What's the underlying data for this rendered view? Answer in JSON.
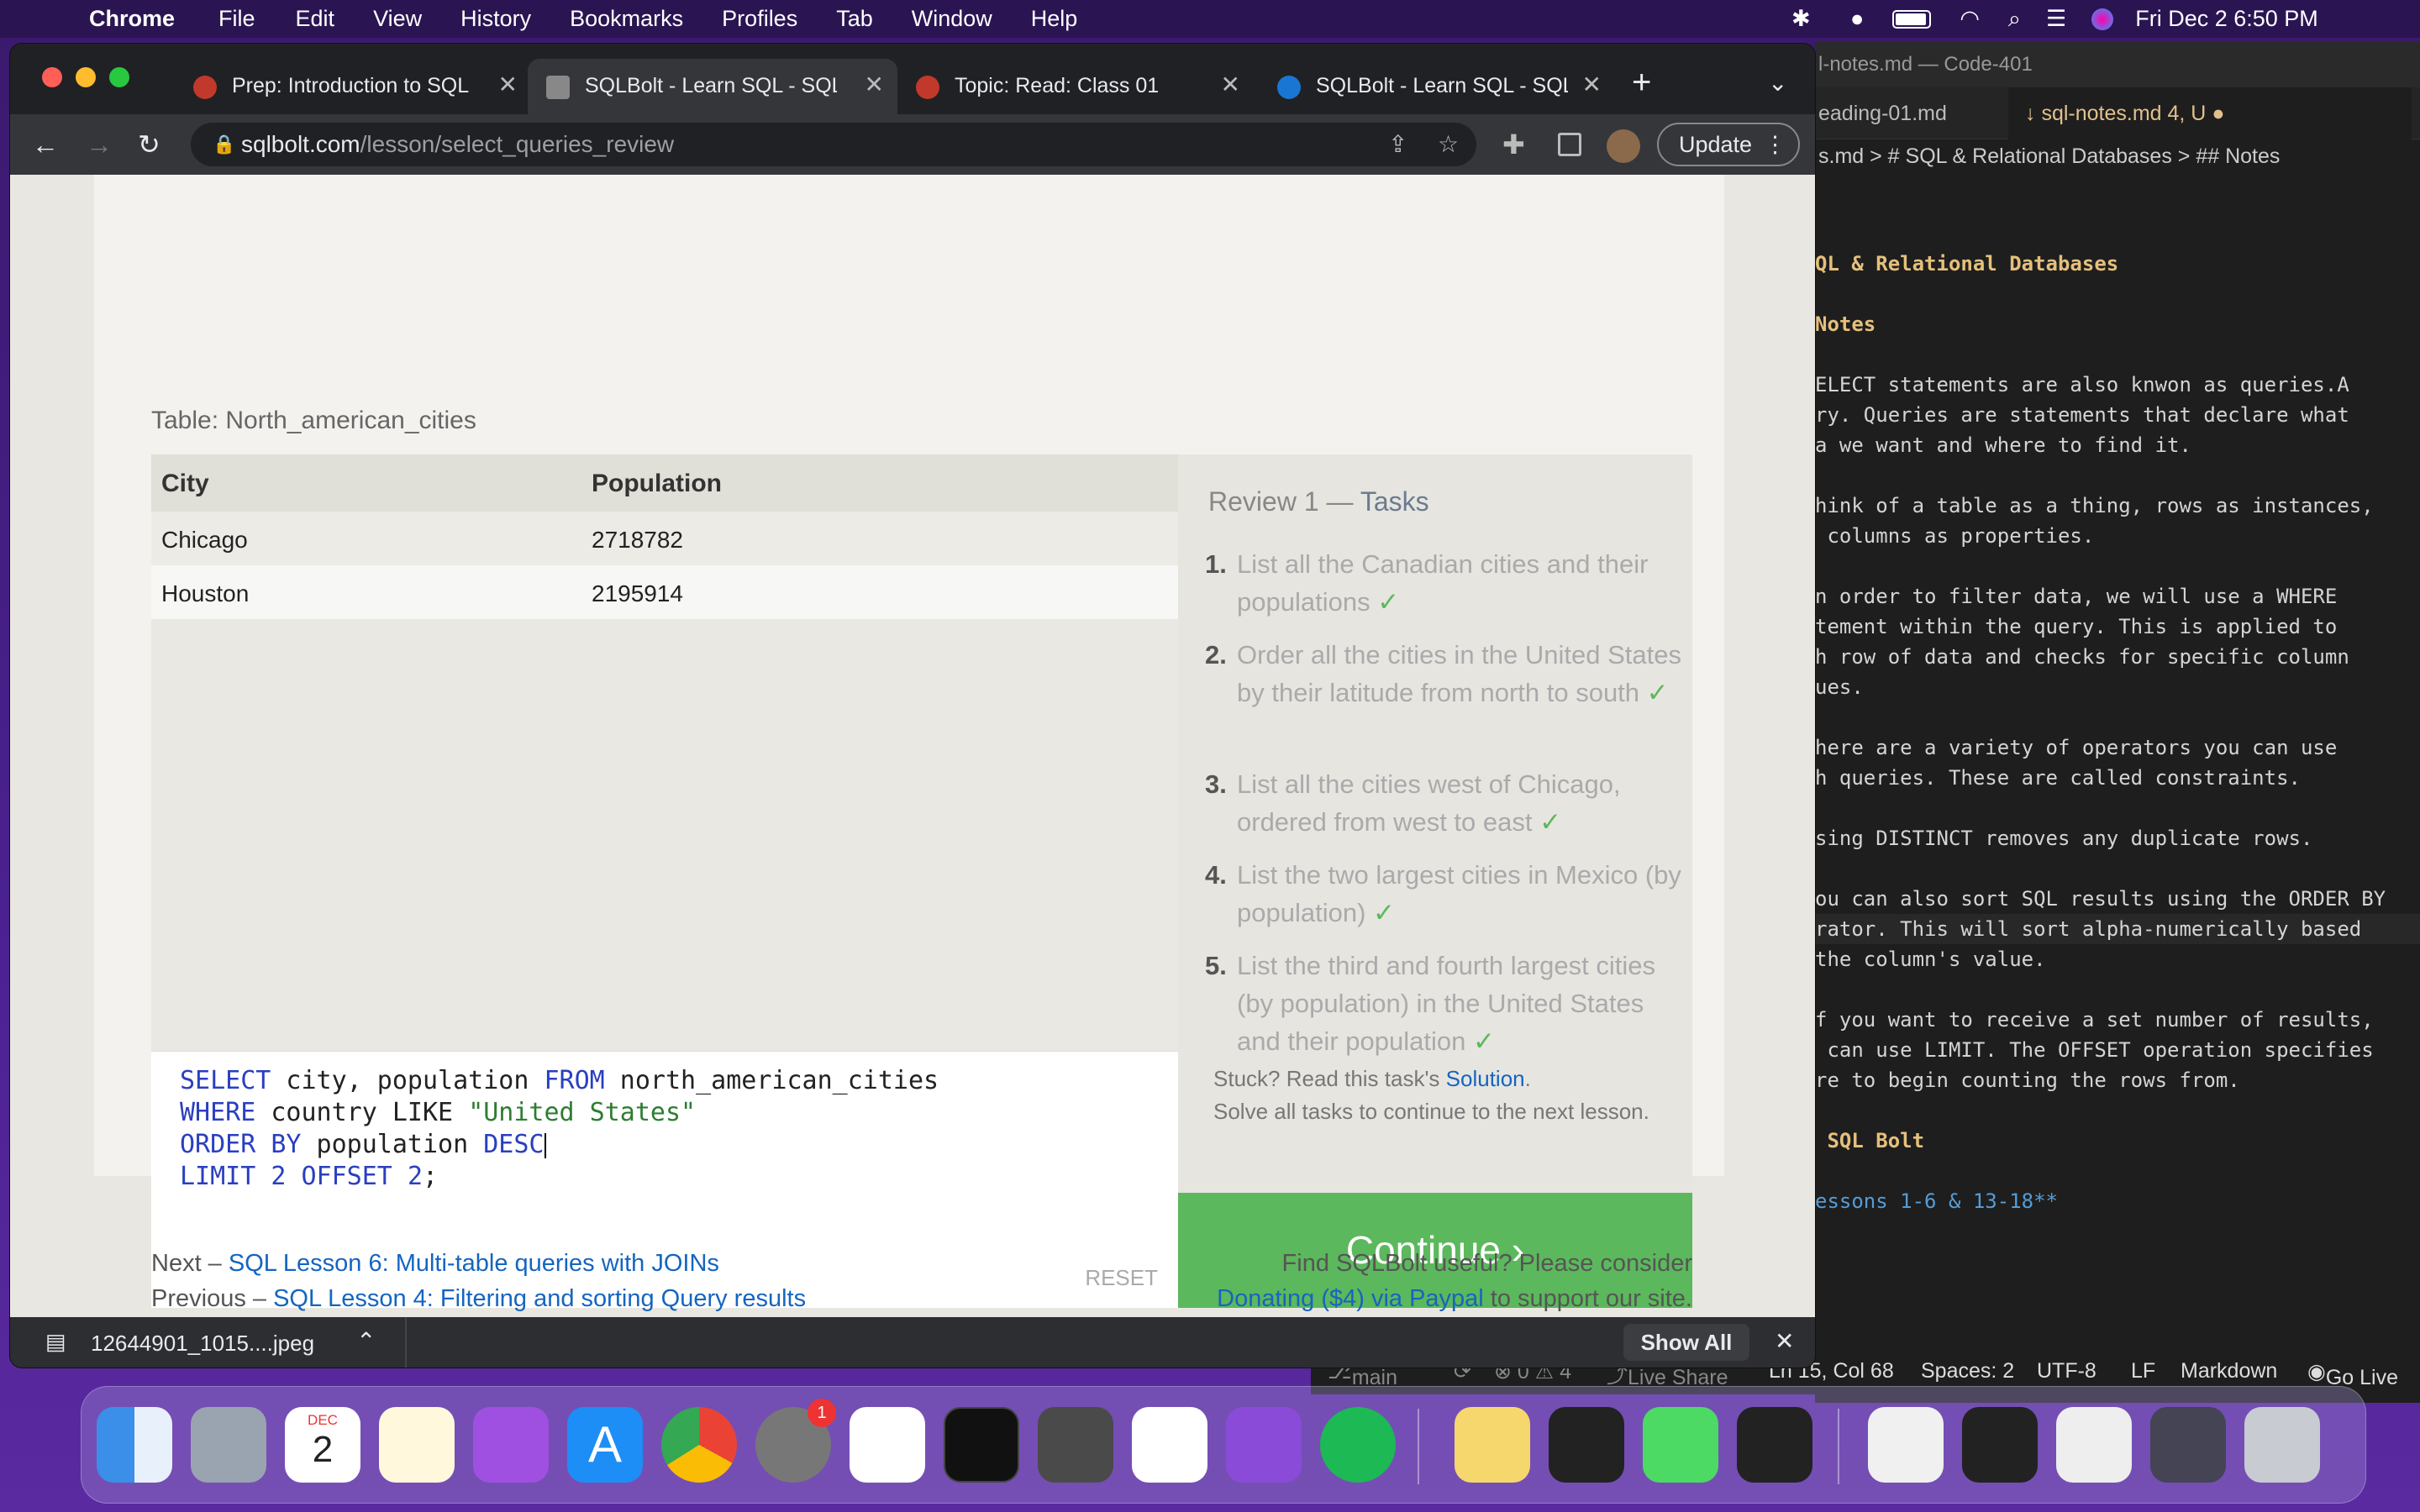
{
  "menubar": {
    "app": "Chrome",
    "items": [
      "File",
      "Edit",
      "View",
      "History",
      "Bookmarks",
      "Profiles",
      "Tab",
      "Window",
      "Help"
    ],
    "clock": "Fri Dec 2  6:50 PM"
  },
  "browser": {
    "tabs": [
      {
        "label": "Prep: Introduction to SQL",
        "active": false
      },
      {
        "label": "SQLBolt - Learn SQL - SQL",
        "active": true
      },
      {
        "label": "Topic: Read: Class 01",
        "active": false
      },
      {
        "label": "SQLBolt - Learn SQL - SQL",
        "active": false
      }
    ],
    "new_tab": "+",
    "url_domain": "sqlbolt.com",
    "url_path": "/lesson/select_queries_review",
    "update_label": "Update"
  },
  "lesson": {
    "table_name": "Table: North_american_cities",
    "columns": [
      "City",
      "Population"
    ],
    "rows": [
      [
        "Chicago",
        "2718782"
      ],
      [
        "Houston",
        "2195914"
      ]
    ],
    "query_lines": [
      [
        "SELECT",
        " city, population ",
        "FROM",
        " north_american_cities"
      ],
      [
        "WHERE",
        " country LIKE ",
        "\"United States\"",
        ""
      ],
      [
        "ORDER BY",
        " population ",
        "DESC",
        ""
      ],
      [
        "LIMIT",
        " ",
        "2",
        " ",
        "OFFSET",
        " ",
        "2",
        ";"
      ]
    ],
    "reset_label": "RESET",
    "review_title": "Review 1 — ",
    "review_tasks_word": "Tasks",
    "tasks": [
      {
        "num": "1.",
        "text": "List all the Canadian cities and their populations"
      },
      {
        "num": "2.",
        "text": "Order all the cities in the United States by their latitude from north to south"
      },
      {
        "num": "3.",
        "text": "List all the cities west of Chicago, ordered from west to east"
      },
      {
        "num": "4.",
        "text": "List the two largest cities in Mexico (by population)"
      },
      {
        "num": "5.",
        "text": "List the third and fourth largest cities (by population) in the United States and their population"
      }
    ],
    "check": "✓",
    "stuck_text": "Stuck? Read this task's ",
    "solution_link": "Solution",
    "solve_all": "Solve all tasks to continue to the next lesson.",
    "continue_label": "Continue ›",
    "next_prefix": "Next – ",
    "next_link": "SQL Lesson 6: Multi-table queries with JOINs",
    "prev_prefix": "Previous – ",
    "prev_link": "SQL Lesson 4: Filtering and sorting Query results",
    "donate_text": "Find SQLBolt useful? Please consider",
    "donate_link": "Donating ($4) via Paypal",
    "donate_suffix": " to support our site."
  },
  "download": {
    "file": "12644901_1015....jpeg",
    "show_all": "Show All"
  },
  "vscode": {
    "title": "l-notes.md — Code-401",
    "tab1": "eading-01.md",
    "tab2": "sql-notes.md 4, U",
    "breadcrumb": "s.md > # SQL & Relational Databases > ## Notes",
    "lines": [
      "QL & Relational Databases",
      "",
      "Notes",
      "",
      "ELECT statements are also knwon as queries.A",
      "ry. Queries are statements that declare what",
      "a we want and where to find it.",
      "",
      "hink of a table as a thing, rows as instances,",
      " columns as properties.",
      "",
      "n order to filter data, we will use a WHERE",
      "tement within the query. This is applied to",
      "h row of data and checks for specific column",
      "ues.",
      "",
      "here are a variety of operators you can use",
      "h queries. These are called constraints.",
      "",
      "sing DISTINCT removes any duplicate rows.",
      "",
      "ou can also sort SQL results using the ORDER BY",
      "rator. This will sort alpha-numerically based",
      "the column's value.",
      "",
      "f you want to receive a set number of results,",
      " can use LIMIT. The OFFSET operation specifies",
      "re to begin counting the rows from.",
      "",
      " SQL Bolt",
      "",
      "essons 1-6 & 13-18**"
    ],
    "status": {
      "branch": "main",
      "problems": "⊗ 0 ⚠ 4",
      "live_share": "Live Share",
      "position": "Ln 15, Col 68",
      "spaces": "Spaces: 2",
      "encoding": "UTF-8",
      "eol": "LF",
      "language": "Markdown",
      "go_live": "Go Live"
    }
  },
  "dock": {
    "calendar_month": "DEC",
    "calendar_day": "2",
    "settings_badge": "1"
  }
}
